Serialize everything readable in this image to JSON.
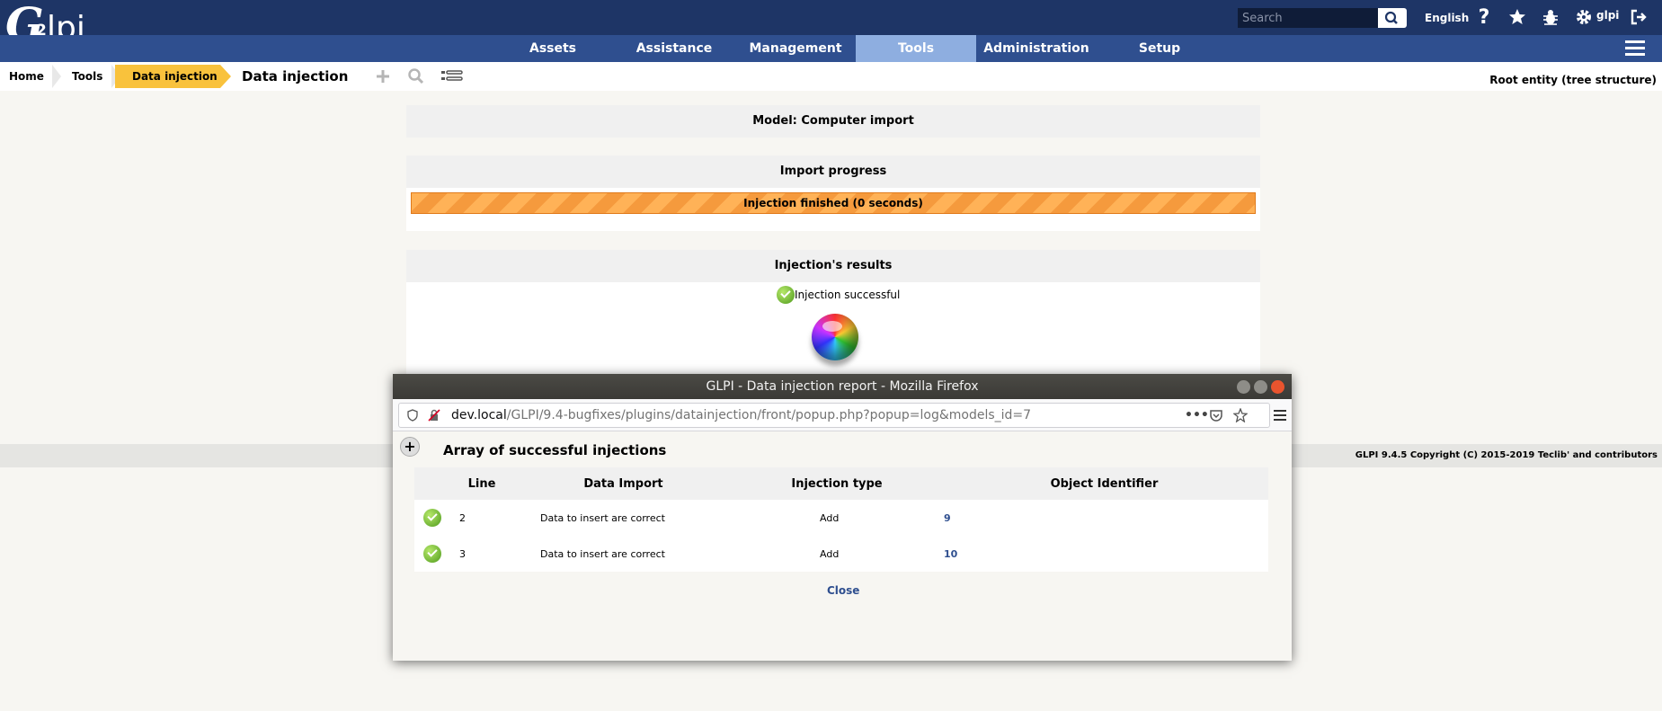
{
  "header": {
    "logo_text": "Glpi",
    "search_placeholder": "Search",
    "language": "English",
    "user": "glpi",
    "icons": [
      "search-icon",
      "help-icon",
      "star-icon",
      "bug-icon",
      "gear-icon",
      "logout-icon"
    ]
  },
  "menu": {
    "items": [
      {
        "label": "Assets"
      },
      {
        "label": "Assistance"
      },
      {
        "label": "Management"
      },
      {
        "label": "Tools",
        "active": true
      },
      {
        "label": "Administration"
      },
      {
        "label": "Setup"
      }
    ]
  },
  "breadcrumb": {
    "items": [
      "Home",
      "Tools",
      "Data injection"
    ],
    "title": "Data injection",
    "entity": "Root entity (tree structure)"
  },
  "main": {
    "model_header": "Model: Computer import",
    "progress_header": "Import progress",
    "progress_text": "Injection finished (0 seconds)",
    "progress_value": 1.0,
    "results_header": "Injection's results",
    "success_text": "Injection successful"
  },
  "footer": {
    "text": "GLPI 9.4.5 Copyright (C) 2015-2019 Teclib' and contributors"
  },
  "popup": {
    "window_title": "GLPI - Data injection report - Mozilla Firefox",
    "url_host": "dev.local",
    "url_path": "/GLPI/9.4-bugfixes/plugins/datainjection/front/popup.php?popup=log&models_id=7",
    "heading": "Array of successful injections",
    "columns": [
      "Line",
      "Data Import",
      "Injection type",
      "Object Identifier"
    ],
    "rows": [
      {
        "line": "2",
        "data_import": "Data to insert are correct",
        "injection_type": "Add",
        "object_id": "9"
      },
      {
        "line": "3",
        "data_import": "Data to insert are correct",
        "injection_type": "Add",
        "object_id": "10"
      }
    ],
    "close_label": "Close"
  },
  "colors": {
    "header_bg": "#1e3566",
    "menu_bg": "#2f4f8f",
    "menu_active": "#8eaee0",
    "breadcrumb_active": "#f9c23c",
    "progress_orange": "#f59a3d"
  }
}
